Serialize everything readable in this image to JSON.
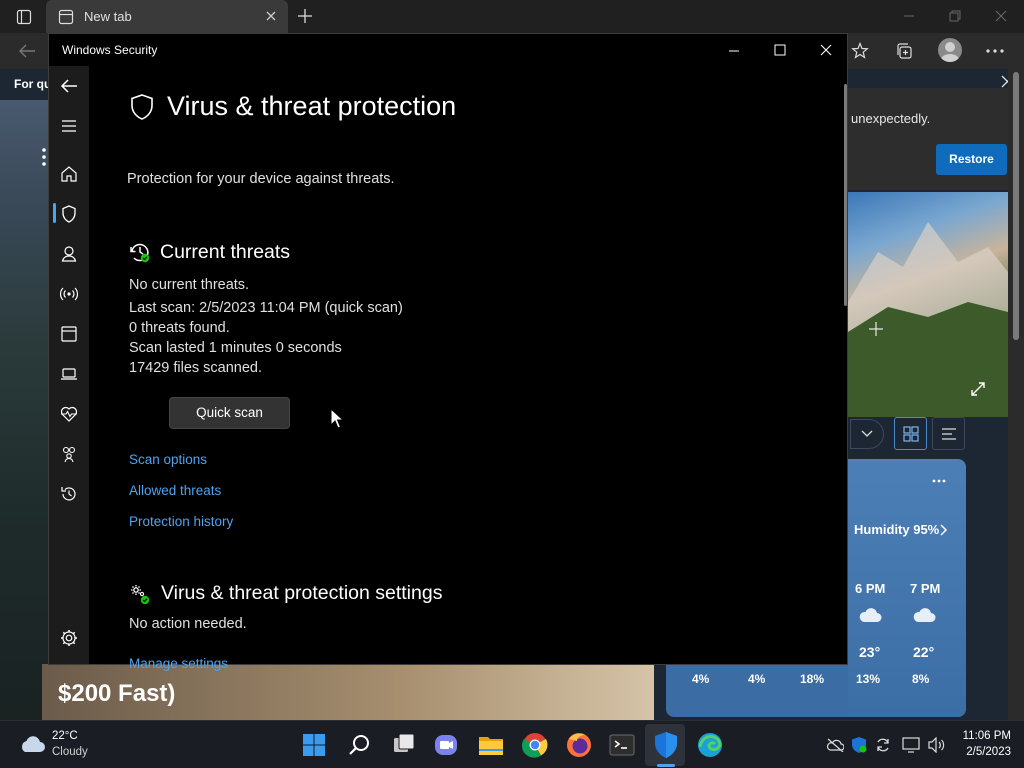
{
  "browser": {
    "tab_title": "New tab",
    "bookmark_hint": "For qu",
    "restore_message": "unexpectedly.",
    "restore_button": "Restore",
    "news_headline": "$200 Fast)",
    "weather": {
      "humidity": "Humidity 95%",
      "hours": [
        {
          "time": "6 PM",
          "temp": "23°",
          "precip": "18%"
        },
        {
          "time": "7 PM",
          "temp": "22°",
          "precip": "13%"
        }
      ],
      "precip_row": [
        "4%",
        "4%",
        "18%",
        "13%",
        "8%"
      ]
    }
  },
  "window": {
    "title": "Windows Security"
  },
  "page": {
    "title": "Virus & threat protection",
    "subtitle": "Protection for your device against threats.",
    "current_threats": {
      "heading": "Current threats",
      "status": "No current threats.",
      "last_scan": "Last scan: 2/5/2023 11:04 PM (quick scan)",
      "threats_found": "0 threats found.",
      "duration": "Scan lasted 1 minutes 0 seconds",
      "files_scanned": "17429 files scanned.",
      "quick_scan_button": "Quick scan",
      "links": [
        "Scan options",
        "Allowed threats",
        "Protection history"
      ]
    },
    "settings": {
      "heading": "Virus & threat protection settings",
      "status": "No action needed.",
      "link": "Manage settings"
    }
  },
  "nav_icons": [
    "back-arrow-icon",
    "hamburger-menu-icon",
    "home-icon",
    "shield-icon",
    "account-icon",
    "network-icon",
    "app-browser-icon",
    "device-security-icon",
    "health-icon",
    "family-icon",
    "history-icon",
    "settings-icon"
  ],
  "taskbar": {
    "weather_temp": "22°C",
    "weather_condition": "Cloudy",
    "time": "11:06 PM",
    "date": "2/5/2023",
    "apps": [
      "start",
      "search",
      "task-view",
      "teams-chat",
      "file-explorer",
      "chrome",
      "firefox",
      "terminal",
      "windows-security",
      "edge"
    ]
  },
  "colors": {
    "accent_link": "#4ea3f0",
    "status_green": "#16c60c",
    "restore_blue": "#0f6cbd"
  }
}
